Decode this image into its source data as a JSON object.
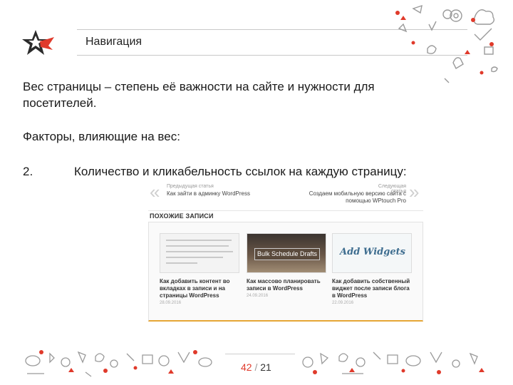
{
  "header": {
    "title": "Навигация"
  },
  "content": {
    "paragraph": "Вес страницы – степень её важности на сайте и нужности для посетителей.",
    "factors_heading": "Факторы, влияющие на вес:",
    "item_number": "2.",
    "item_text": "Количество и кликабельность ссылок на каждую страницу:"
  },
  "screenshot": {
    "prev_label": "Предыдущая статья",
    "prev_title": "Как зайти в админку WordPress",
    "next_label": "Следующая статья",
    "next_title": "Создаем мобильную версию сайта с помощью WPtouch Pro",
    "related_label": "ПОХОЖИЕ ЗАПИСИ",
    "thumb2_text": "Bulk Schedule Drafts",
    "thumb3_text": "Add Widgets",
    "cards": [
      {
        "title": "Как добавить контент во вкладках в записи и на страницы WordPress",
        "date": "28.09.2016"
      },
      {
        "title": "Как массово планировать записи в WordPress",
        "date": "24.09.2016"
      },
      {
        "title": "Как добавить собственный виджет после записи блога в WordPress",
        "date": "22.09.2016"
      }
    ]
  },
  "footer": {
    "current_page": "42",
    "separator": "/",
    "total_pages": "21"
  },
  "colors": {
    "accent_red": "#e03a2b",
    "dark": "#222222",
    "doodle_gray": "#9a9a9a",
    "orange_border": "#e6a636"
  }
}
